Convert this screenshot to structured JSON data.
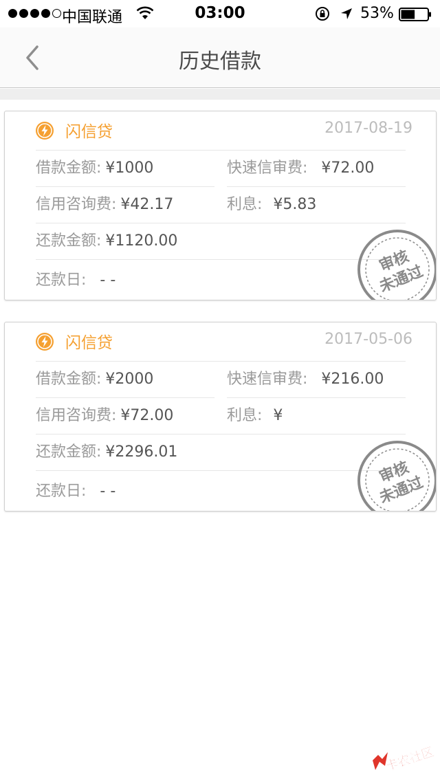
{
  "status": {
    "carrier": "中国联通",
    "time": "03:00",
    "battery_pct": "53%",
    "battery_level": 0.53
  },
  "nav": {
    "back_icon": "chevron-left-icon",
    "title": "历史借款"
  },
  "loans": [
    {
      "brand": "闪信贷",
      "date": "2017-08-19",
      "amount_label": "借款金额:",
      "amount": "¥1000",
      "fee_label": "快速信审费:",
      "fee": "¥72.00",
      "consult_label": "信用咨询费:",
      "consult": "¥42.17",
      "interest_label": "利息:",
      "interest": "¥5.83",
      "repay_label": "还款金额:",
      "repay": "¥1120.00",
      "due_label": "还款日:",
      "due": "- -",
      "stamp_text": "审核未通过"
    },
    {
      "brand": "闪信贷",
      "date": "2017-05-06",
      "amount_label": "借款金额:",
      "amount": "¥2000",
      "fee_label": "快速信审费:",
      "fee": "¥216.00",
      "consult_label": "信用咨询费:",
      "consult": "¥72.00",
      "interest_label": "利息:",
      "interest": "¥",
      "repay_label": "还款金额:",
      "repay": "¥2296.01",
      "due_label": "还款日:",
      "due": "- -",
      "stamp_text": "审核未通过"
    }
  ],
  "watermark": "卡农社区",
  "colors": {
    "brand": "#f5a031",
    "stamp": "#8a8a8a"
  }
}
